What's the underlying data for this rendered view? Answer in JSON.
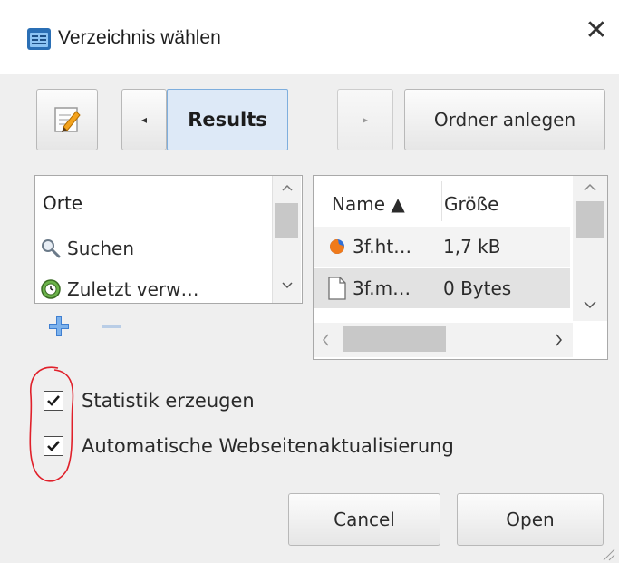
{
  "window": {
    "title": "Verzeichnis wählen",
    "close_glyph": "✕",
    "icon": "folder-dialog-icon"
  },
  "toolbar": {
    "edit_icon": "edit-path-icon",
    "back_glyph": "◂",
    "breadcrumb_current": "Results",
    "forward_glyph": "▸",
    "create_folder_label": "Ordner anlegen"
  },
  "places": {
    "header": "Orte",
    "items": [
      {
        "label": "Suchen",
        "icon": "search-icon"
      },
      {
        "label": "Zuletzt verw…",
        "icon": "recent-icon"
      }
    ],
    "add_glyph": "+",
    "remove_glyph": "−"
  },
  "files": {
    "columns": {
      "name": "Name ▲",
      "size": "Größe"
    },
    "rows": [
      {
        "name": "3f.ht…",
        "size": "1,7 kB",
        "icon": "firefox-html-icon"
      },
      {
        "name": "3f.m…",
        "size": "0 Bytes",
        "icon": "blank-file-icon"
      }
    ]
  },
  "options": {
    "statistics": {
      "label": "Statistik erzeugen",
      "checked": true
    },
    "auto_update": {
      "label": "Automatische Webseitenaktualisierung",
      "checked": true
    }
  },
  "actions": {
    "cancel_label": "Cancel",
    "open_label": "Open"
  },
  "colors": {
    "accent": "#7eaedd",
    "selected_bg": "#dde9f7",
    "annotation": "#e0202a",
    "add_icon": "#3f7fd1"
  }
}
